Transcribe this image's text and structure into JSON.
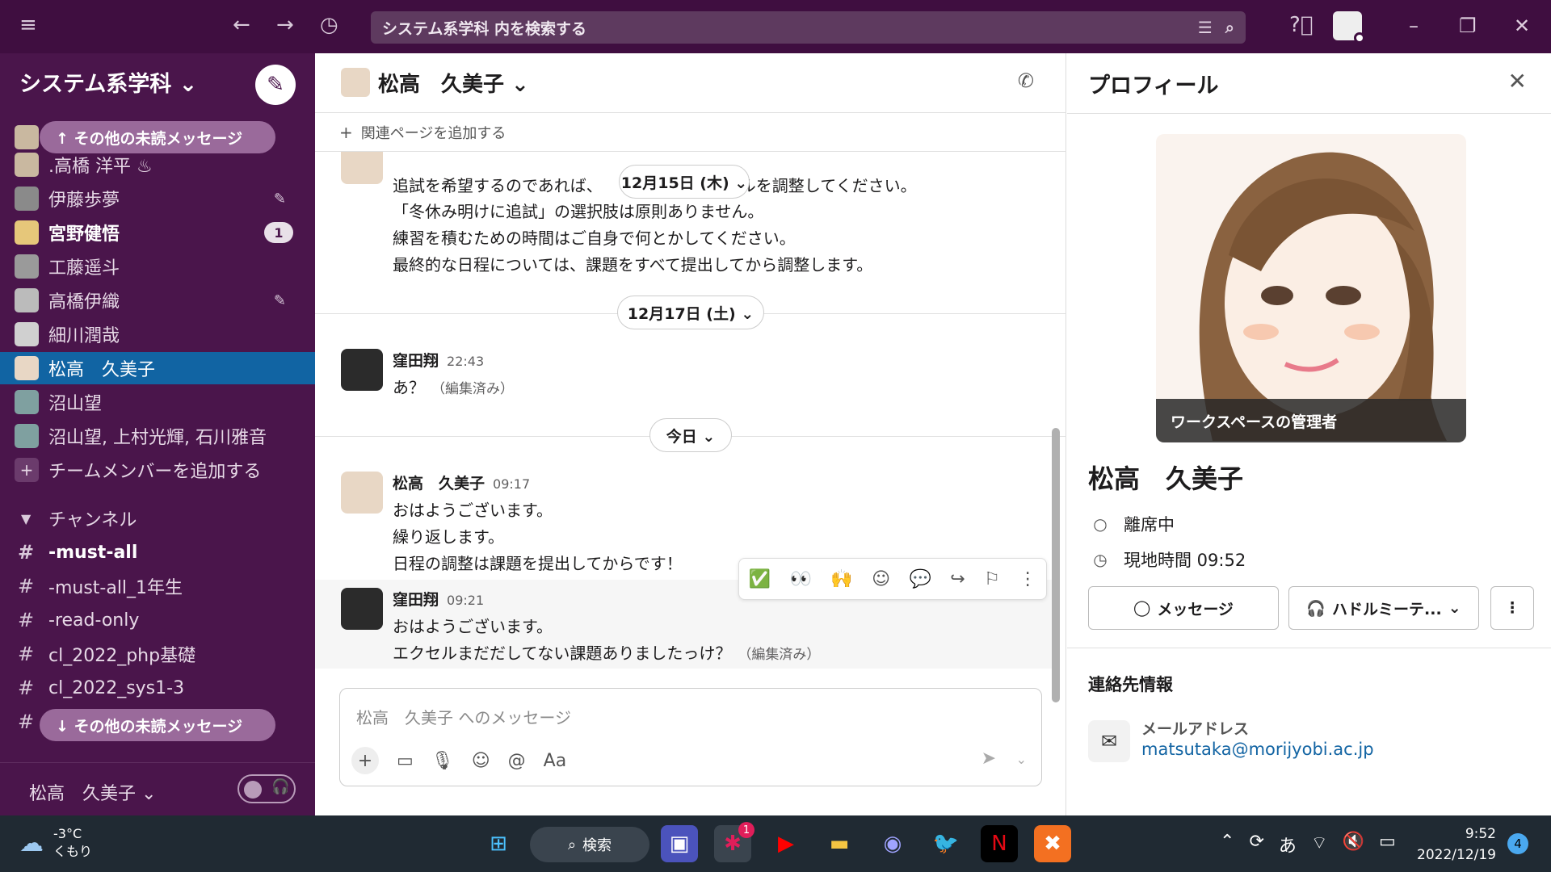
{
  "topbar": {
    "search_placeholder": "システム系学科 内を検索する"
  },
  "sidebar": {
    "workspace_name": "システム系学科 ⌄",
    "unread_above": "↑  その他の未読メッセージ",
    "unread_below": "↓  その他の未読メッセージ",
    "dms": [
      {
        "label": ".高橋 洋平 ♨"
      },
      {
        "label": "伊藤歩夢"
      },
      {
        "label": "宮野健悟",
        "badge": "1"
      },
      {
        "label": "工藤遥斗"
      },
      {
        "label": "高橋伊織"
      },
      {
        "label": "細川潤哉"
      },
      {
        "label": "松高　久美子"
      },
      {
        "label": "沼山望"
      },
      {
        "label": "沼山望, 上村光輝, 石川雅音"
      },
      {
        "label": "チームメンバーを追加する"
      }
    ],
    "channels_header": "チャンネル",
    "channels": [
      {
        "label": "-must-all"
      },
      {
        "label": "-must-all_1年生"
      },
      {
        "label": "-read-only"
      },
      {
        "label": "cl_2022_php基礎"
      },
      {
        "label": "cl_2022_sys1-3"
      }
    ],
    "footer_name": "松高　久美子 ⌄"
  },
  "channel": {
    "title": "松高　久美子 ⌄",
    "add_bookmark": "関連ページを追加する",
    "messages_top": {
      "lines": [
        "追試を希望するのであれば、",
        "ールを調整してください。",
        "「冬休み明けに追試」の選択肢は原則ありません。",
        "練習を積むための時間はご自身で何とかしてください。",
        "最終的な日程については、課題をすべて提出してから調整します。"
      ]
    },
    "dates": {
      "d1": "12月15日 (木) ⌄",
      "d2": "12月17日 (土) ⌄",
      "d3": "今日 ⌄"
    },
    "msg1": {
      "name": "窪田翔",
      "time": "22:43",
      "text": "あ？",
      "edited": "（編集済み）"
    },
    "msg2": {
      "name": "松高　久美子",
      "time": "09:17",
      "lines": [
        "おはようございます。",
        "繰り返します。",
        "日程の調整は課題を提出してからです！"
      ]
    },
    "msg3": {
      "name": "窪田翔",
      "time": "09:21",
      "lines": [
        "おはようございます。",
        "エクセルまだだしてない課題ありましたっけ？"
      ],
      "edited": "（編集済み）"
    },
    "composer_placeholder": "松高　久美子 へのメッセージ"
  },
  "profile": {
    "header": "プロフィール",
    "admin_label": "ワークスペースの管理者",
    "name": "松高　久美子",
    "status": "離席中",
    "local_time": "現地時間 09:52",
    "message_btn": "メッセージ",
    "huddle_btn": "ハドルミーテ...",
    "contact_header": "連絡先情報",
    "email_label": "メールアドレス",
    "email": "matsutaka@morijyobi.ac.jp"
  },
  "taskbar": {
    "temp": "-3°C",
    "weather": "くもり",
    "search": "検索",
    "slack_badge": "1",
    "time": "9:52",
    "date": "2022/12/19",
    "notif_count": "4",
    "ime": "あ"
  }
}
